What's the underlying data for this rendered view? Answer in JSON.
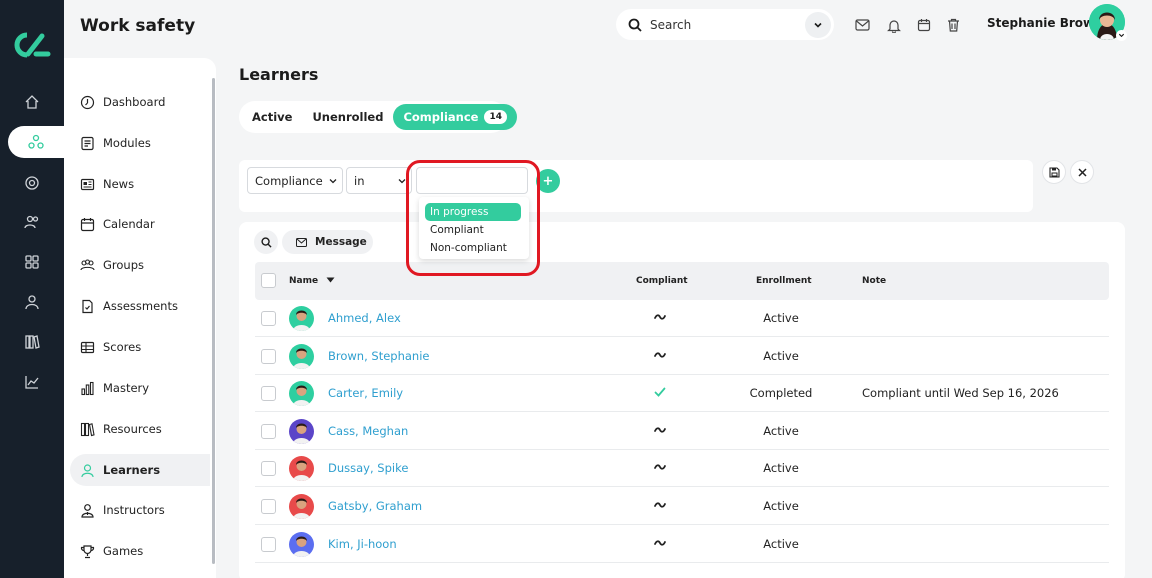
{
  "app": {
    "title": "Work safety"
  },
  "header": {
    "search_placeholder": "Search",
    "user_name": "Stephanie Brown"
  },
  "rail": {
    "items": [
      "home-icon",
      "network-icon",
      "target-icon",
      "people-icon",
      "apps-icon",
      "user-icon",
      "library-icon",
      "chart-icon"
    ],
    "active_index": 1
  },
  "sidebar": {
    "items": [
      {
        "label": "Dashboard",
        "icon": "dashboard-icon"
      },
      {
        "label": "Modules",
        "icon": "modules-icon"
      },
      {
        "label": "News",
        "icon": "news-icon"
      },
      {
        "label": "Calendar",
        "icon": "calendar-icon"
      },
      {
        "label": "Groups",
        "icon": "groups-icon"
      },
      {
        "label": "Assessments",
        "icon": "assessments-icon"
      },
      {
        "label": "Scores",
        "icon": "scores-icon"
      },
      {
        "label": "Mastery",
        "icon": "mastery-icon"
      },
      {
        "label": "Resources",
        "icon": "resources-icon"
      },
      {
        "label": "Learners",
        "icon": "learners-icon"
      },
      {
        "label": "Instructors",
        "icon": "instructors-icon"
      },
      {
        "label": "Games",
        "icon": "games-icon"
      }
    ],
    "active": "Learners"
  },
  "page": {
    "title": "Learners"
  },
  "tabs": [
    {
      "label": "Active"
    },
    {
      "label": "Unenrolled"
    },
    {
      "label": "Compliance",
      "badge": "14",
      "selected": true
    }
  ],
  "filter": {
    "field": "Compliance",
    "operator": "in",
    "value": "",
    "options": [
      "In progress",
      "Compliant",
      "Non-compliant"
    ],
    "highlighted_option": "In progress"
  },
  "toolbar": {
    "message_label": "Message"
  },
  "table": {
    "columns": {
      "name": "Name",
      "compliant": "Compliant",
      "enrollment": "Enrollment",
      "note": "Note"
    },
    "rows": [
      {
        "name": "Ahmed, Alex",
        "compliant": "in-progress",
        "enrollment": "Active",
        "note": "",
        "avatar_color": "#2ecfa0"
      },
      {
        "name": "Brown, Stephanie",
        "compliant": "in-progress",
        "enrollment": "Active",
        "note": "",
        "avatar_color": "#2ecfa0"
      },
      {
        "name": "Carter, Emily",
        "compliant": "compliant",
        "enrollment": "Completed",
        "note": "Compliant until Wed Sep 16, 2026",
        "avatar_color": "#2ecfa0"
      },
      {
        "name": "Cass, Meghan",
        "compliant": "in-progress",
        "enrollment": "Active",
        "note": "",
        "avatar_color": "#5b45c8"
      },
      {
        "name": "Dussay, Spike",
        "compliant": "in-progress",
        "enrollment": "Active",
        "note": "",
        "avatar_color": "#e84a4a"
      },
      {
        "name": "Gatsby, Graham",
        "compliant": "in-progress",
        "enrollment": "Active",
        "note": "",
        "avatar_color": "#e84a4a"
      },
      {
        "name": "Kim, Ji-hoon",
        "compliant": "in-progress",
        "enrollment": "Active",
        "note": "",
        "avatar_color": "#5b6ef0"
      }
    ]
  },
  "colors": {
    "accent": "#33cc9e",
    "link": "#2f9fcf",
    "rail": "#17202b",
    "highlight_box": "#e01822"
  }
}
